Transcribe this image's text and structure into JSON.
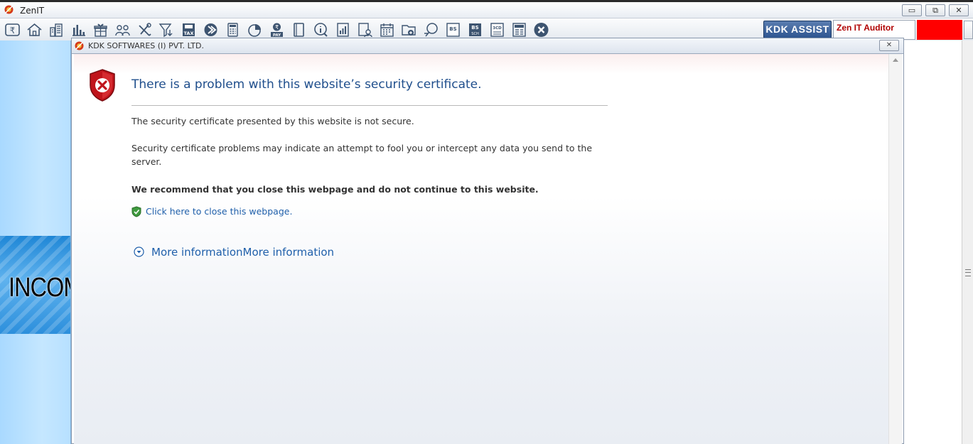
{
  "app": {
    "title": "ZenIT",
    "window_buttons": {
      "minimize": "▭",
      "restore": "⧉",
      "close": "✕"
    }
  },
  "toolbar": {
    "icons": [
      "rupee-icon",
      "home-icon",
      "building-icon",
      "bar-chart-icon",
      "gift-icon",
      "users-icon",
      "tools-icon",
      "filter-icon",
      "tax-icon",
      "arrow-circle-icon",
      "calculator-icon",
      "pie-icon",
      "pay-icon",
      "book-icon",
      "info-icon",
      "report-icon",
      "user-doc-icon",
      "calendar-icon",
      "folder-icon",
      "globe-icon",
      "bs-icon",
      "bs-sch-icon",
      "3cd-icon",
      "form-icon",
      "close-circle-icon"
    ],
    "tax_label": "TAX",
    "pay_label": "PAY",
    "bs_label": "BS",
    "sch_label": "SCH",
    "cd_label": "3CD",
    "kdk_assist": "KDK ASSIST",
    "auditor": "Zen IT Auditor",
    "accent_red": "#ff0000"
  },
  "sidebar": {
    "banner_text": "INCOM"
  },
  "dialog": {
    "title": "KDK SOFTWARES (I) PVT. LTD.",
    "close": "✕"
  },
  "page": {
    "heading": "There is a problem with this website’s security certificate.",
    "p1": "The security certificate presented by this website is not secure.",
    "p2": "Security certificate problems may indicate an attempt to fool you or intercept any data you send to the server.",
    "recommend": "We recommend that you close this webpage and do not continue to this website.",
    "close_link": "Click here to close this webpage.",
    "more_info": "More informationMore information",
    "colors": {
      "heading": "#1f4e8c",
      "link": "#1f5faa",
      "shield_red": "#c0141b"
    }
  }
}
